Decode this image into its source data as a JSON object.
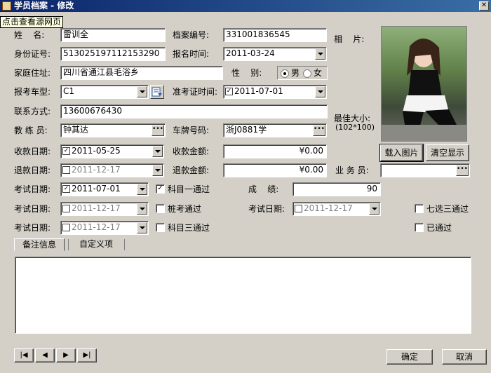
{
  "window": {
    "title": "学员档案 - 修改"
  },
  "tooltip": "点击查看源网页",
  "form": {
    "name_label": "姓    名:",
    "name_value": "雷训全",
    "file_no_label": "档案编号:",
    "file_no_value": "331001836545",
    "photo_label": "相    片:",
    "id_label": "身份证号:",
    "id_value": "513025197112153290",
    "signup_time_label": "报名时间:",
    "signup_time_value": "2011-03-24",
    "address_label": "家庭住址:",
    "address_value": "四川省通江县毛浴乡",
    "gender_label": "性    别:",
    "gender_male": "男",
    "gender_female": "女",
    "gender_selected": "男",
    "car_type_label": "报考车型:",
    "car_type_value": "C1",
    "permit_time_label": "准考证时间:",
    "permit_time_value": "2011-07-01",
    "contact_label": "联系方式:",
    "contact_value": "13600676430",
    "max_size_label": "最佳大小:",
    "max_size_value": "(102*100)",
    "coach_label": "教 练 员:",
    "coach_value": "钟其达",
    "plate_label": "车牌号码:",
    "plate_value": "浙J0881学",
    "receipt_date_label": "收款日期:",
    "receipt_date_value": "2011-05-25",
    "receipt_amount_label": "收款金额:",
    "receipt_amount_value": "¥0.00",
    "refund_date_label": "退款日期:",
    "refund_date_value": "2011-12-17",
    "refund_amount_label": "退款金额:",
    "refund_amount_value": "¥0.00",
    "salesman_label": "业 务 员:",
    "salesman_value": "",
    "exam1_label": "考试日期:",
    "exam1_value": "2011-07-01",
    "subject1_label": "科目一通过",
    "score_label": "成    绩:",
    "score_value": "90",
    "exam2_label": "考试日期:",
    "exam2_value": "2011-12-17",
    "pile_label": "桩考通过",
    "exam3_label": "考试日期:",
    "exam3_value": "2011-12-17",
    "seven_label": "七选三通过",
    "exam4_label": "考试日期:",
    "exam4_value": "2011-12-17",
    "subject3_label": "科目三通过",
    "passed_label": "已通过",
    "load_photo_button": "载入图片",
    "clear_button": "清空显示"
  },
  "tabs": [
    {
      "label": "备注信息"
    },
    {
      "label": "自定义项"
    }
  ],
  "nav": {
    "first": "|◀",
    "prev": "◀",
    "next": "▶",
    "last": "▶|"
  },
  "footer": {
    "ok": "确定",
    "cancel": "取消"
  }
}
